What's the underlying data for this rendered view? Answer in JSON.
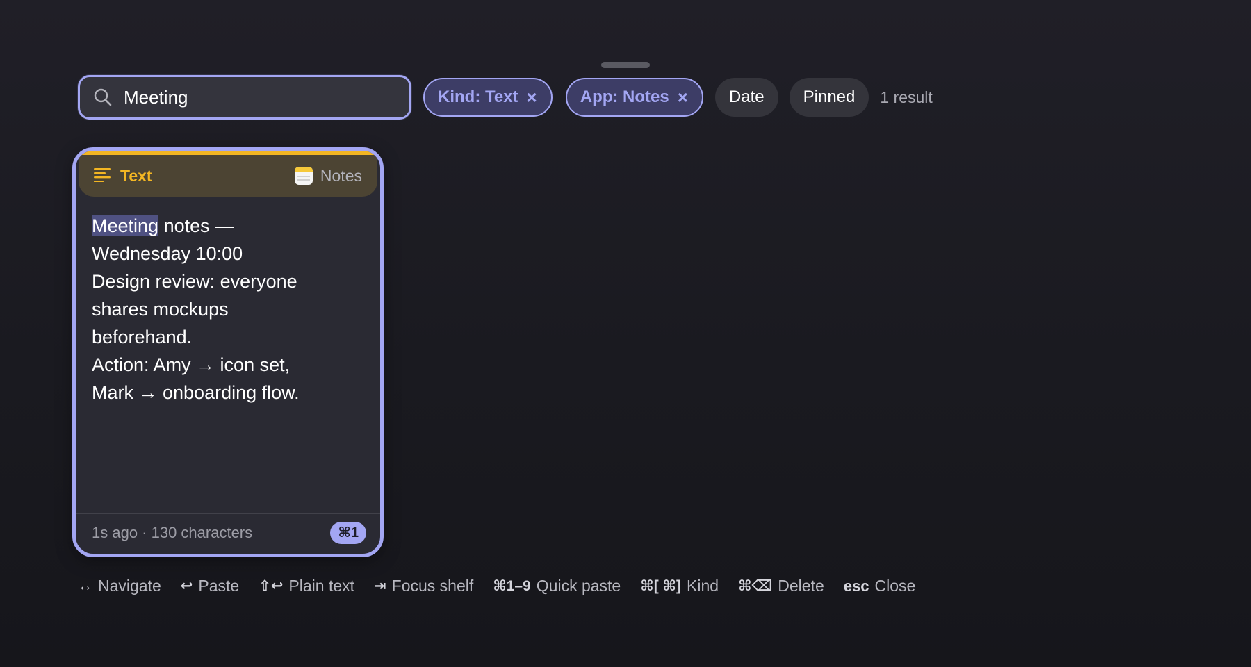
{
  "search": {
    "value": "Meeting",
    "icon": "search-icon"
  },
  "filters": {
    "kind": {
      "label": "Kind: Text",
      "remove": "×"
    },
    "app": {
      "label": "App: Notes",
      "remove": "×"
    },
    "date": {
      "label": "Date"
    },
    "pinned": {
      "label": "Pinned"
    },
    "result_count": "1 result"
  },
  "card": {
    "kind_label": "Text",
    "kind_icon": "text-lines-icon",
    "app_label": "Notes",
    "app_icon": "notes-app-icon",
    "highlight": "Meeting",
    "line1_rest": " notes —",
    "lines": [
      "Wednesday 10:00",
      "Design review: everyone",
      "shares mockups",
      "beforehand.",
      "Action: Amy → icon set,",
      "Mark → onboarding flow."
    ],
    "meta": "1s ago · 130 characters",
    "shortcut": "⌘1"
  },
  "hints": [
    {
      "key": "↔",
      "label": "Navigate"
    },
    {
      "key": "↩",
      "label": "Paste"
    },
    {
      "key": "⇧↩",
      "label": "Plain text"
    },
    {
      "key": "⇥",
      "label": "Focus shelf"
    },
    {
      "key": "⌘1–9",
      "label": "Quick paste"
    },
    {
      "key": "⌘[ ⌘]",
      "label": "Kind"
    },
    {
      "key": "⌘⌫",
      "label": "Delete"
    },
    {
      "key": "esc",
      "label": "Close"
    }
  ],
  "colors": {
    "accent": "#a3a6f3",
    "kind_text": "#f3b623",
    "background": "#1a1a20"
  }
}
